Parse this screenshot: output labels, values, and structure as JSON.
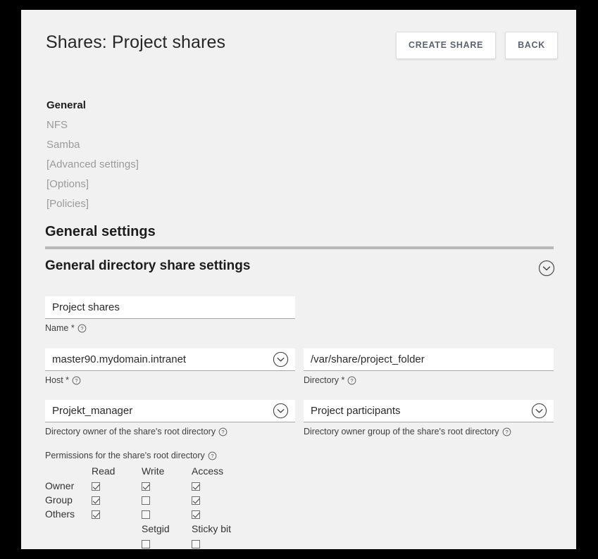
{
  "header": {
    "title": "Shares: Project shares",
    "buttons": [
      {
        "label": "CREATE SHARE",
        "name": "create-share-button"
      },
      {
        "label": "BACK",
        "name": "back-button"
      }
    ]
  },
  "nav": {
    "items": [
      {
        "label": "General",
        "active": true
      },
      {
        "label": "NFS",
        "active": false
      },
      {
        "label": "Samba",
        "active": false
      },
      {
        "label": "[Advanced settings]",
        "active": false
      },
      {
        "label": "[Options]",
        "active": false
      },
      {
        "label": "[Policies]",
        "active": false
      }
    ]
  },
  "sections": {
    "general_settings_heading": "General settings",
    "directory_share_heading": "General directory share settings"
  },
  "form": {
    "name": {
      "value": "Project shares",
      "label": "Name *",
      "placeholder": ""
    },
    "host": {
      "value": "master90.mydomain.intranet",
      "label": "Host *",
      "placeholder": ""
    },
    "directory": {
      "value": "/var/share/project_folder",
      "label": "Directory *",
      "placeholder": ""
    },
    "owner": {
      "value": "Projekt_manager",
      "label": "Directory owner of the share's root directory",
      "placeholder": ""
    },
    "owner_group": {
      "value": "Project participants",
      "label": "Directory owner group of the share's root directory",
      "placeholder": ""
    }
  },
  "permissions": {
    "caption": "Permissions for the share's root directory",
    "columns": [
      "Read",
      "Write",
      "Access"
    ],
    "rows": [
      {
        "label": "Owner",
        "read": true,
        "write": true,
        "access": true
      },
      {
        "label": "Group",
        "read": true,
        "write": false,
        "access": true
      },
      {
        "label": "Others",
        "read": true,
        "write": false,
        "access": true
      }
    ],
    "extra": {
      "setgid_label": "Setgid",
      "setgid_checked": false,
      "sticky_label": "Sticky bit",
      "sticky_checked": false
    }
  },
  "icons": {
    "collapse": "chevron-down-circle-icon",
    "dropdown": "chevron-down-circle-icon",
    "help": "help-circle-icon"
  },
  "colors": {
    "panel_bg": "#f1f1f1",
    "frame": "#000000",
    "button_text": "#5d6470",
    "nav_inactive": "#9a9a9a",
    "divider": "#b8b8b8"
  }
}
